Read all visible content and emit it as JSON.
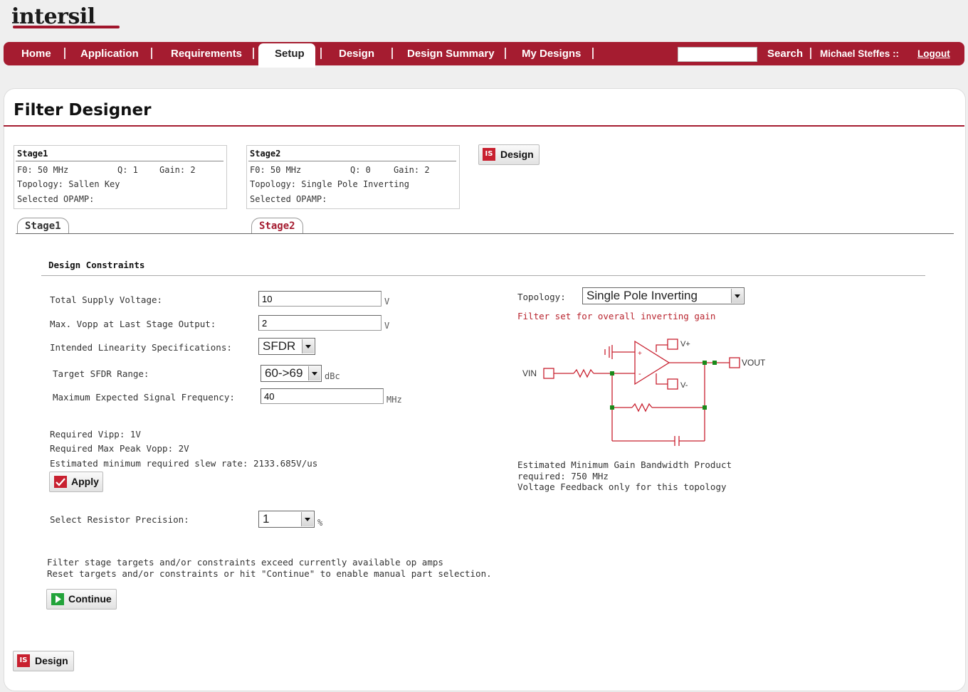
{
  "brand": {
    "logo": "intersil"
  },
  "nav": {
    "items": [
      "Home",
      "Application",
      "Requirements",
      "Setup",
      "Design",
      "Design Summary",
      "My Designs"
    ],
    "active": "Setup",
    "search_label": "Search",
    "user_name": "Michael Steffes",
    "user_sep": "::",
    "logout": "Logout"
  },
  "page": {
    "title": "Filter Designer"
  },
  "stages": [
    {
      "title": "Stage1",
      "f0": "F0: 50 MHz",
      "q": "Q: 1",
      "gain": "Gain: 2",
      "topology": "Topology: Sallen Key",
      "opamp": "Selected OPAMP:"
    },
    {
      "title": "Stage2",
      "f0": "F0: 50 MHz",
      "q": "Q: 0",
      "gain": "Gain: 2",
      "topology": "Topology: Single Pole Inverting",
      "opamp": "Selected OPAMP:"
    }
  ],
  "design_button": "Design",
  "tabs": [
    "Stage1",
    "Stage2"
  ],
  "active_tab": "Stage2",
  "constraints": {
    "heading": "Design Constraints",
    "supply_label": "Total Supply Voltage:",
    "supply_value": "10",
    "supply_unit": "V",
    "vopp_label": "Max. Vopp at Last Stage Output:",
    "vopp_value": "2",
    "vopp_unit": "V",
    "linearity_label": "Intended Linearity Specifications:",
    "linearity_value": "SFDR",
    "sfdr_label": "Target SFDR Range:",
    "sfdr_value": "60->69",
    "sfdr_unit": "dBc",
    "freq_label": "Maximum Expected Signal Frequency:",
    "freq_value": "40",
    "freq_unit": "MHz",
    "req_vipp": "Required Vipp: 1V",
    "req_vopp": "Required Max Peak Vopp: 2V",
    "slew": "Estimated minimum required slew rate: 2133.685V/us",
    "apply": "Apply",
    "resistor_label": "Select Resistor Precision:",
    "resistor_value": "1",
    "resistor_unit": "%",
    "warning_line1": "Filter stage targets and/or constraints exceed currently available op amps",
    "warning_line2": "Reset targets and/or constraints or hit \"Continue\" to enable manual part selection.",
    "continue": "Continue"
  },
  "topology": {
    "label": "Topology:",
    "value": "Single Pole Inverting",
    "note": "Filter set for overall inverting gain",
    "schematic": {
      "vin": "VIN",
      "vout": "VOUT",
      "vplus": "V+",
      "vminus": "V-",
      "plus_sign": "+",
      "minus_sign": "-"
    },
    "gbw_line1": "Estimated Minimum Gain Bandwidth Product",
    "gbw_line2": "required: 750 MHz",
    "vfb_note": "Voltage Feedback only for this topology"
  },
  "colors": {
    "brand_red": "#a51c30",
    "note_red": "#b9252f",
    "schematic_red": "#c8202f",
    "node_green": "#1a8a1a"
  }
}
